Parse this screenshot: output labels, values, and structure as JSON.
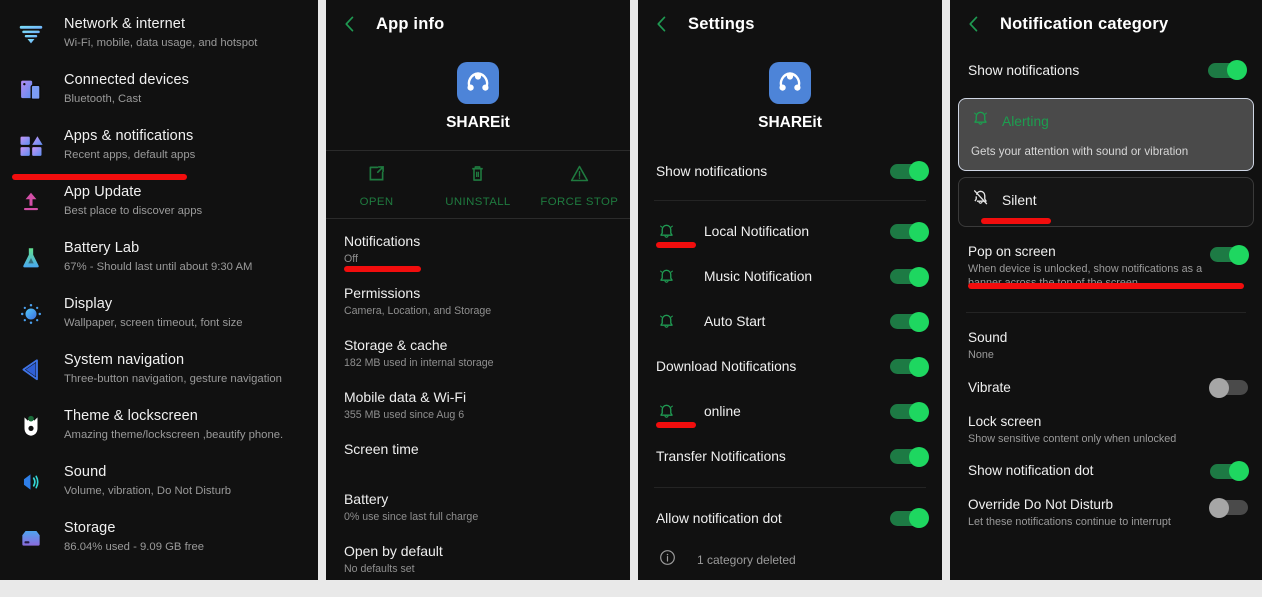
{
  "colors": {
    "accent_green": "#1ed760",
    "toggle_on": "#1ed760",
    "toggle_off": "#a6a6a6",
    "annotation_red": "#f20d0d",
    "panel_bg": "#111111",
    "app_icon_blue": "#4d84d8"
  },
  "panel1": {
    "name": "android-settings-list",
    "items": [
      {
        "icon": "wifi-icon",
        "title": "Network & internet",
        "subtitle": "Wi-Fi, mobile, data usage, and hotspot"
      },
      {
        "icon": "connected-devices-icon",
        "title": "Connected devices",
        "subtitle": "Bluetooth, Cast"
      },
      {
        "icon": "apps-icon",
        "title": "Apps & notifications",
        "subtitle": "Recent apps, default apps",
        "highlighted": true
      },
      {
        "icon": "upload-arrow-icon",
        "title": "App Update",
        "subtitle": "Best place to discover apps"
      },
      {
        "icon": "flask-icon",
        "title": "Battery Lab",
        "subtitle": "67% - Should last until about 9:30 AM"
      },
      {
        "icon": "brightness-icon",
        "title": "Display",
        "subtitle": "Wallpaper, screen timeout, font size"
      },
      {
        "icon": "navigation-arrow-icon",
        "title": "System navigation",
        "subtitle": "Three-button navigation, gesture navigation"
      },
      {
        "icon": "theme-mask-icon",
        "title": "Theme & lockscreen",
        "subtitle": "Amazing theme/lockscreen ,beautify phone."
      },
      {
        "icon": "speaker-icon",
        "title": "Sound",
        "subtitle": "Volume, vibration, Do Not Disturb"
      },
      {
        "icon": "storage-icon",
        "title": "Storage",
        "subtitle": "86.04% used - 9.09 GB free"
      }
    ]
  },
  "panel2": {
    "name": "app-info-screen",
    "back_icon": "back-chevron-icon",
    "title": "App info",
    "app_name": "SHAREit",
    "app_icon": "shareit-app-icon",
    "actions": [
      {
        "icon": "open-external-icon",
        "label": "OPEN"
      },
      {
        "icon": "trash-icon",
        "label": "UNINSTALL"
      },
      {
        "icon": "warning-triangle-icon",
        "label": "FORCE STOP"
      }
    ],
    "items": [
      {
        "title": "Notifications",
        "subtitle": "Off",
        "highlighted": true
      },
      {
        "title": "Permissions",
        "subtitle": "Camera, Location, and Storage"
      },
      {
        "title": "Storage & cache",
        "subtitle": "182 MB used in internal storage"
      },
      {
        "title": "Mobile data & Wi-Fi",
        "subtitle": "355 MB used since Aug 6"
      },
      {
        "title": "Screen time",
        "subtitle": ""
      },
      {
        "title": "Battery",
        "subtitle": "0% use since last full charge"
      },
      {
        "title": "Open by default",
        "subtitle": "No defaults set"
      }
    ]
  },
  "panel3": {
    "name": "app-notification-settings-screen",
    "back_icon": "back-chevron-icon",
    "title": "Settings",
    "app_name": "SHAREit",
    "app_icon": "shareit-app-icon",
    "show_notifications": {
      "label": "Show notifications",
      "state": "on"
    },
    "channels": [
      {
        "icon": "bell-ring-icon",
        "label": "Local Notification",
        "state": "on",
        "highlighted": true
      },
      {
        "icon": "bell-ring-icon",
        "label": "Music Notification",
        "state": "on"
      },
      {
        "icon": "bell-ring-icon",
        "label": "Auto Start",
        "state": "on"
      },
      {
        "icon": "",
        "label": "Download Notifications",
        "state": "on"
      },
      {
        "icon": "bell-ring-icon",
        "label": "online",
        "state": "on",
        "highlighted": true
      },
      {
        "icon": "",
        "label": "Transfer Notifications",
        "state": "on"
      }
    ],
    "allow_dot": {
      "label": "Allow notification dot",
      "state": "on"
    },
    "footer": {
      "icon": "info-circle-icon",
      "text": "1 category deleted"
    }
  },
  "panel4": {
    "name": "notification-category-screen",
    "back_icon": "back-chevron-icon",
    "title": "Notification category",
    "show_notifications": {
      "label": "Show notifications",
      "state": "on"
    },
    "importance_options": [
      {
        "icon": "bell-ring-icon",
        "label": "Alerting",
        "desc": "Gets your attention with sound or vibration",
        "selected": true
      },
      {
        "icon": "bell-off-icon",
        "label": "Silent",
        "desc": "",
        "selected": false,
        "highlighted": true
      }
    ],
    "prefs": [
      {
        "title": "Pop on screen",
        "subtitle": "When device is unlocked, show notifications as a banner across the top of the screen",
        "toggle": "on",
        "highlighted": true
      },
      {
        "title": "Sound",
        "subtitle": "None",
        "toggle": ""
      },
      {
        "title": "Vibrate",
        "subtitle": "",
        "toggle": "off"
      },
      {
        "title": "Lock screen",
        "subtitle": "Show sensitive content only when unlocked",
        "toggle": ""
      },
      {
        "title": "Show notification dot",
        "subtitle": "",
        "toggle": "on"
      },
      {
        "title": "Override Do Not Disturb",
        "subtitle": "Let these notifications continue to interrupt",
        "toggle": "off"
      }
    ]
  }
}
